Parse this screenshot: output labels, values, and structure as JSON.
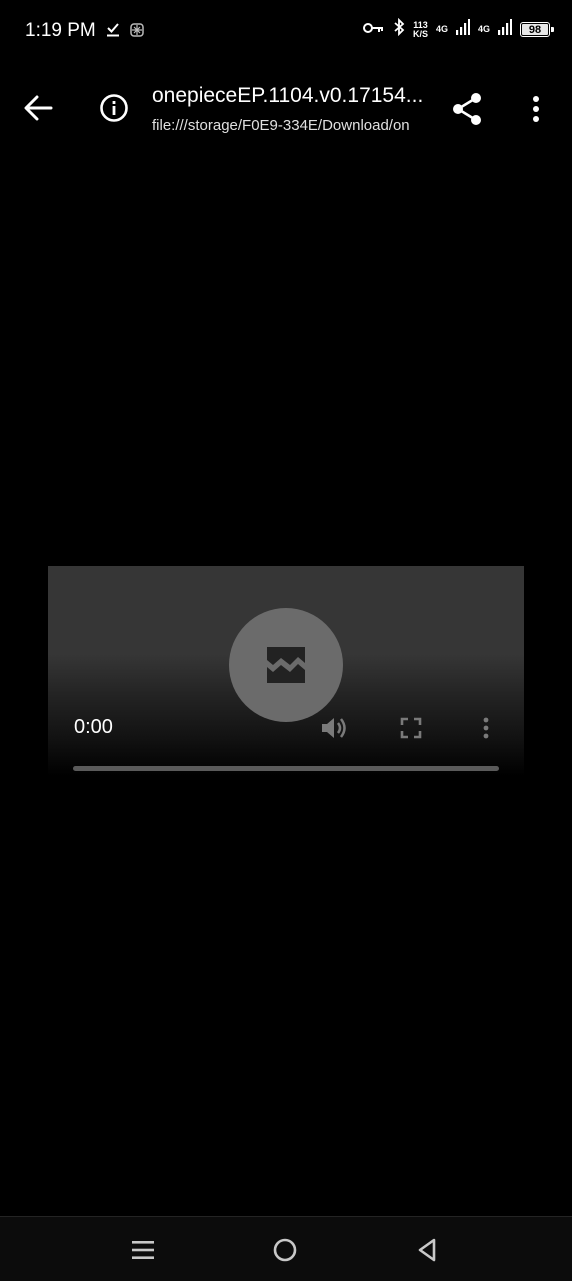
{
  "status_bar": {
    "time": "1:19 PM",
    "speed_value": "113",
    "speed_unit": "K/S",
    "network_1": "4G",
    "network_2": "4G",
    "battery": "98"
  },
  "app_bar": {
    "title": "onepieceEP.1104.v0.17154...",
    "url": "file:///storage/F0E9-334E/Download/on"
  },
  "player": {
    "current_time": "0:00",
    "progress": 0
  },
  "icons": {
    "back": "arrow-left-icon",
    "info": "info-icon",
    "share": "share-icon",
    "more": "more-vertical-icon",
    "broken_media": "broken-image-icon",
    "volume": "volume-icon",
    "fullscreen": "fullscreen-icon",
    "nav_menu": "menu-icon",
    "nav_home": "home-circle-icon",
    "nav_back": "triangle-back-icon"
  }
}
